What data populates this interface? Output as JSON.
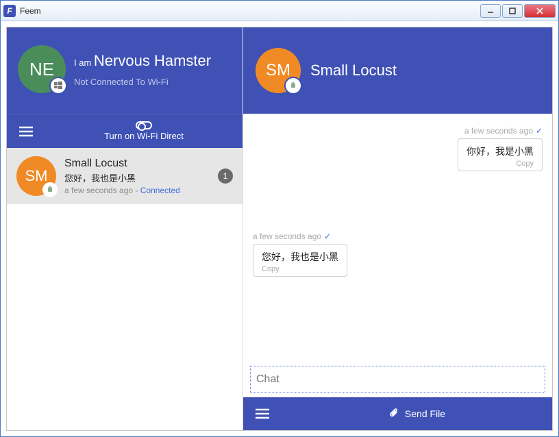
{
  "window": {
    "title": "Feem",
    "icon_letter": "F"
  },
  "profile": {
    "initials": "NE",
    "iam_prefix": "I am",
    "name": "Nervous Hamster",
    "wifi_status": "Not Connected To Wi-Fi",
    "platform_icon": "windows"
  },
  "wifidirect": {
    "label": "Turn on Wi-Fi Direct"
  },
  "devices": [
    {
      "initials": "SM",
      "name": "Small Locust",
      "preview": "您好，我也是小黑",
      "time": "a few seconds ago",
      "separator": " - ",
      "status": "Connected",
      "unread": "1",
      "platform_icon": "android"
    }
  ],
  "chat": {
    "header": {
      "initials": "SM",
      "name": "Small Locust",
      "platform_icon": "android"
    },
    "messages": [
      {
        "side": "right",
        "time": "a few seconds ago",
        "text": "你好，我是小黑",
        "copy": "Copy"
      },
      {
        "side": "left",
        "time": "a few seconds ago",
        "text": "您好，我也是小黑",
        "copy": "Copy"
      }
    ],
    "input_placeholder": "Chat",
    "send_file_label": "Send File"
  }
}
